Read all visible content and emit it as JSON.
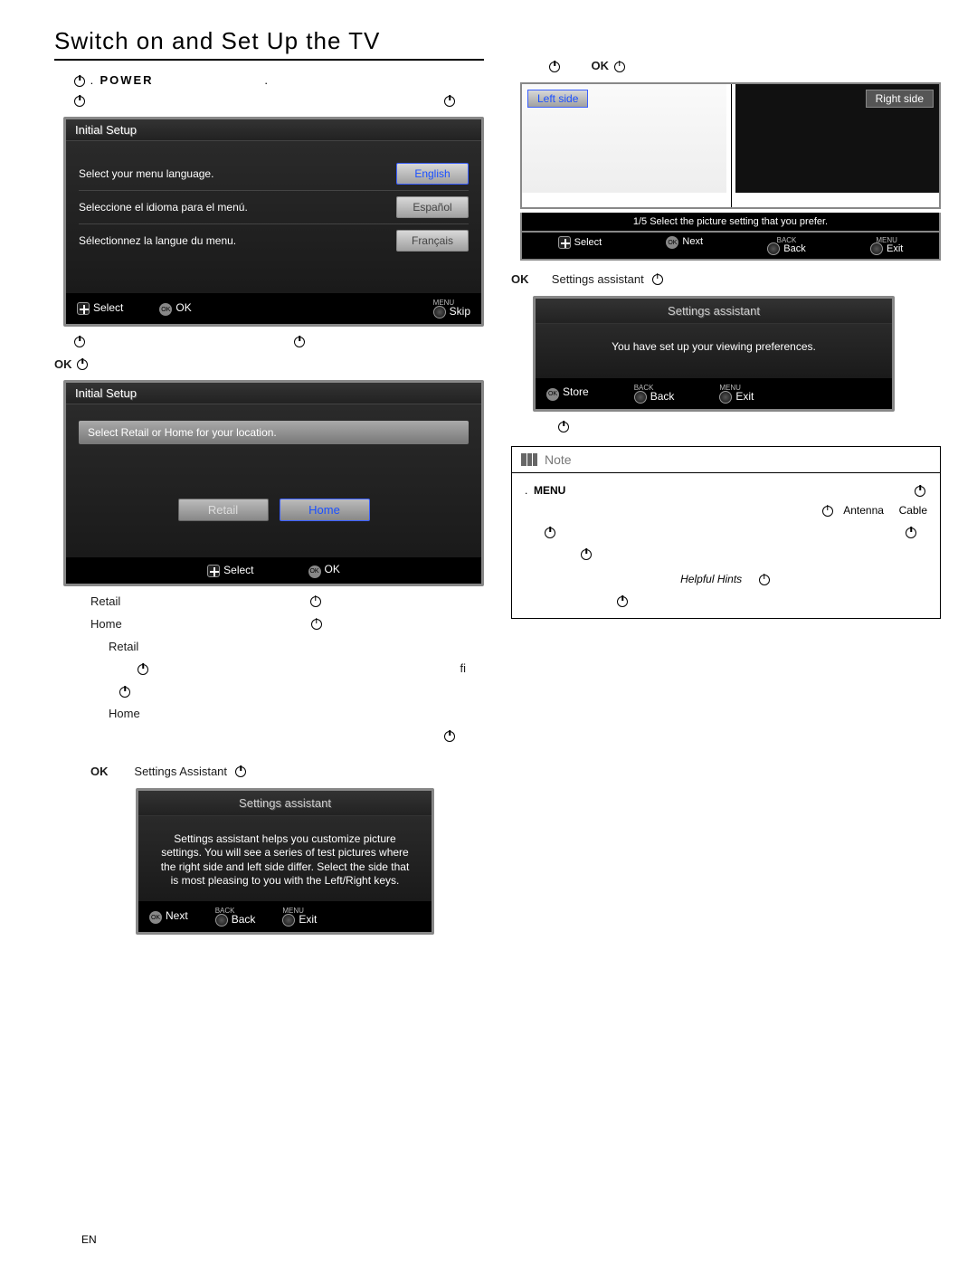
{
  "heading": "Switch on and Set Up the TV",
  "power_word": "POWER",
  "initial_setup": {
    "title": "Initial Setup",
    "rows": [
      {
        "prompt": "Select your menu language.",
        "option": "English",
        "selected": true
      },
      {
        "prompt": "Seleccione el idioma para el menú.",
        "option": "Español",
        "selected": false
      },
      {
        "prompt": "Sélectionnez la langue du menu.",
        "option": "Français",
        "selected": false
      }
    ],
    "footer": {
      "select": "Select",
      "ok": "OK",
      "skip": "Skip",
      "skip_small": "MENU"
    }
  },
  "ok_word": "OK",
  "location_box": {
    "title": "Initial Setup",
    "msg": "Select  Retail  or  Home  for your location.",
    "options": [
      "Retail",
      "Home"
    ],
    "selected": 1,
    "footer": {
      "select": "Select",
      "ok": "OK"
    }
  },
  "loc_labels": {
    "retail": "Retail",
    "home": "Home"
  },
  "settings_assistant_label": "Settings Assistant",
  "assistant_box1": {
    "title": "Settings assistant",
    "body": "Settings assistant helps you customize picture settings. You will see a series of test pictures where the right side and left side differ. Select the side that is most pleasing to you with the Left/Right keys.",
    "footer": {
      "next": "Next",
      "back": "Back",
      "exit": "Exit",
      "back_small": "BACK",
      "exit_small": "MENU"
    }
  },
  "sides": {
    "left": "Left side",
    "right": "Right side",
    "caption": "1/5 Select the picture setting that you prefer.",
    "footer": {
      "select": "Select",
      "next": "Next",
      "back": "Back",
      "exit": "Exit",
      "back_small": "BACK",
      "exit_small": "MENU"
    }
  },
  "settings_assistant_text": "Settings assistant",
  "assistant_box2": {
    "title": "Settings assistant",
    "body": "You have set up your viewing preferences.",
    "footer": {
      "store": "Store",
      "back": "Back",
      "exit": "Exit",
      "back_small": "BACK",
      "exit_small": "MENU"
    }
  },
  "note": {
    "title": "Note",
    "menu": "MENU",
    "antenna": "Antenna",
    "cable": "Cable",
    "hints": "Helpful Hints"
  },
  "footer_lang": "EN"
}
